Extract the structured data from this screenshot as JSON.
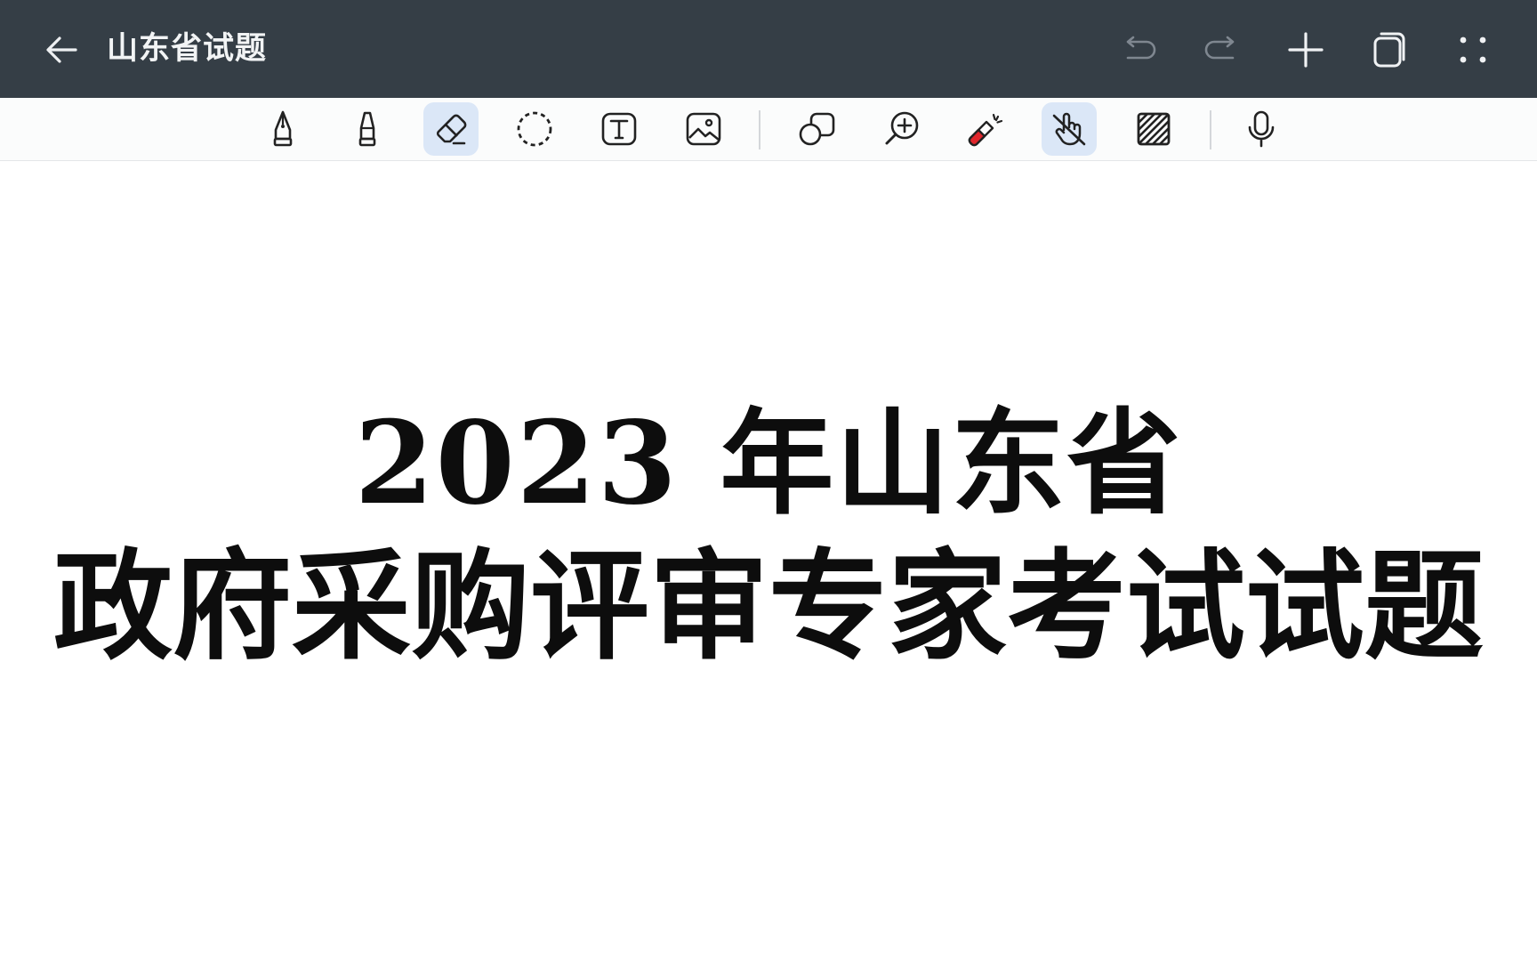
{
  "app": {
    "title": "山东省试题",
    "colors": {
      "topbar_bg": "#353e46",
      "toolbar_bg": "#fbfcfc",
      "active_tool_bg": "#dbe7f7",
      "highlighter_accent": "#e0262c"
    }
  },
  "topbar": {
    "back_icon": "arrow-left-icon",
    "actions": [
      {
        "name": "undo",
        "icon": "undo-icon"
      },
      {
        "name": "redo",
        "icon": "redo-icon"
      },
      {
        "name": "add-page",
        "icon": "plus-icon"
      },
      {
        "name": "pages",
        "icon": "pages-icon"
      },
      {
        "name": "more",
        "icon": "more-grid-icon"
      }
    ]
  },
  "toolbar": {
    "tools": [
      {
        "name": "pen",
        "icon": "fountain-pen-icon",
        "active": false
      },
      {
        "name": "marker",
        "icon": "marker-icon",
        "active": false
      },
      {
        "name": "eraser",
        "icon": "eraser-icon",
        "active": true
      },
      {
        "name": "lasso",
        "icon": "lasso-select-icon",
        "active": false
      },
      {
        "name": "text",
        "icon": "text-box-icon",
        "active": false
      },
      {
        "name": "image",
        "icon": "image-icon",
        "active": false
      },
      {
        "name": "shapes",
        "icon": "shapes-icon",
        "active": false
      },
      {
        "name": "zoom",
        "icon": "zoom-in-icon",
        "active": false
      },
      {
        "name": "laser",
        "icon": "laser-pointer-icon",
        "active": false
      },
      {
        "name": "touch-off",
        "icon": "touch-disabled-icon",
        "active": true
      },
      {
        "name": "background",
        "icon": "hatch-pattern-icon",
        "active": false
      },
      {
        "name": "voice",
        "icon": "microphone-icon",
        "active": false
      }
    ]
  },
  "document": {
    "line1": "2023 年山东省",
    "line2": "政府采购评审专家考试试题"
  }
}
